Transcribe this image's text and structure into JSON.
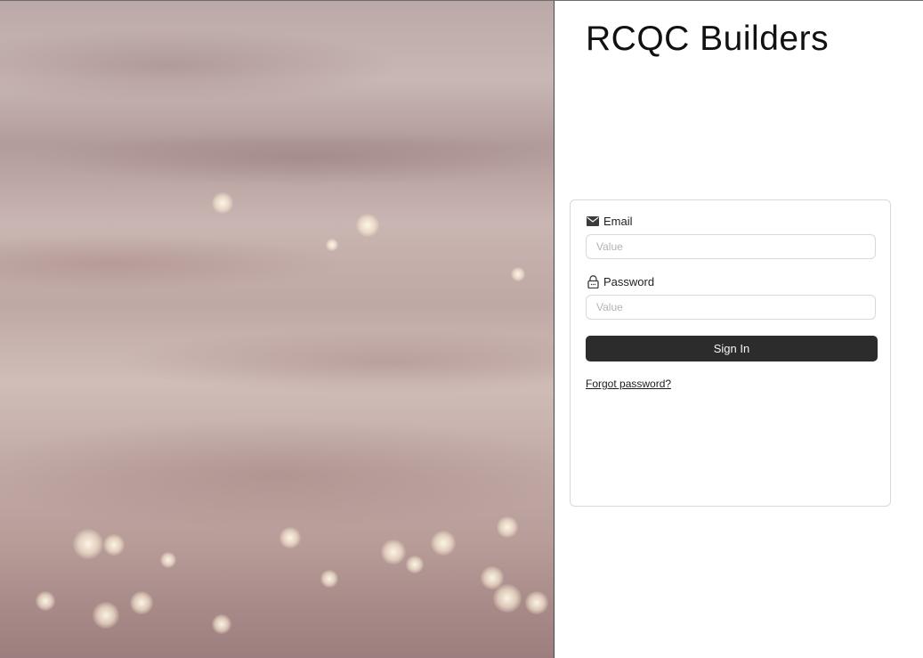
{
  "brand": {
    "name": "RCQC Builders"
  },
  "hero": {
    "image_icon": "water-sparkle-photo"
  },
  "login": {
    "email": {
      "label": "Email",
      "icon": "mail-icon",
      "value": "",
      "placeholder": "Value"
    },
    "password": {
      "label": "Password",
      "icon": "lock-icon",
      "value": "",
      "placeholder": "Value"
    },
    "sign_in_label": "Sign In",
    "forgot_password_label": "Forgot password?"
  },
  "colors": {
    "button_bg": "#2c2c2c",
    "button_text": "#f5f5f5",
    "border": "#d9d9d9",
    "placeholder": "#b3b3b3"
  }
}
